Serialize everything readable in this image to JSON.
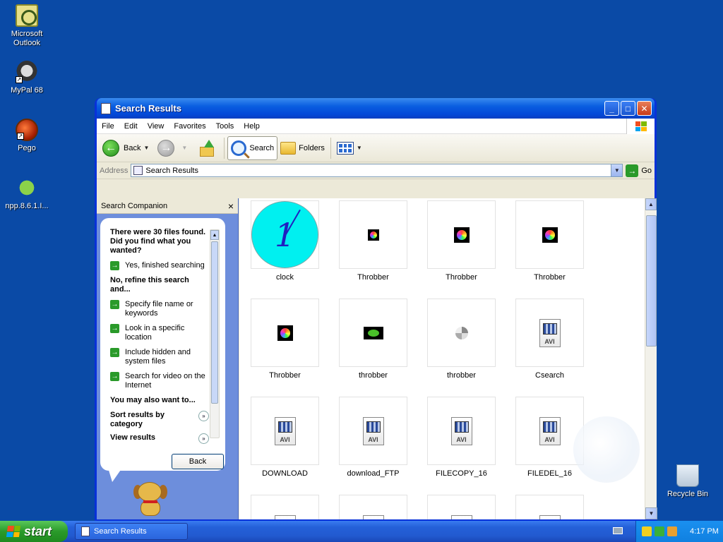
{
  "desktop": {
    "icons": [
      {
        "label": "Microsoft Outlook",
        "icon": "outlook-icon"
      },
      {
        "label": "MyPal 68",
        "icon": "mypal-icon"
      },
      {
        "label": "Pego",
        "icon": "pego-icon"
      },
      {
        "label": "npp.8.6.1.I...",
        "icon": "npp-installer-icon"
      },
      {
        "label": "Recycle Bin",
        "icon": "recycle-bin-icon"
      }
    ]
  },
  "window": {
    "title": "Search Results",
    "menu": [
      "File",
      "Edit",
      "View",
      "Favorites",
      "Tools",
      "Help"
    ],
    "toolbar": {
      "back": "Back",
      "search": "Search",
      "folders": "Folders"
    },
    "address": {
      "label": "Address",
      "value": "Search Results",
      "go": "Go"
    }
  },
  "companion": {
    "title": "Search Companion",
    "close": "×",
    "question": "There were 30 files found. Did you find what you wanted?",
    "yes_option": "Yes, finished searching",
    "refine_heading": "No, refine this search and...",
    "refine_options": [
      "Specify file name or keywords",
      "Look in a specific location",
      "Include hidden and system files",
      "Search for video on the Internet"
    ],
    "also_heading": "You may also want to...",
    "also_options": [
      "Sort results by category",
      "View results"
    ],
    "back_button": "Back"
  },
  "files": [
    {
      "name": "clock",
      "thumb": "clock"
    },
    {
      "name": "Throbber",
      "thumb": "throbber-small"
    },
    {
      "name": "Throbber",
      "thumb": "throbber"
    },
    {
      "name": "Throbber",
      "thumb": "throbber"
    },
    {
      "name": "Throbber",
      "thumb": "throbber"
    },
    {
      "name": "throbber",
      "thumb": "frog"
    },
    {
      "name": "throbber",
      "thumb": "spinner"
    },
    {
      "name": "Csearch",
      "thumb": "avi"
    },
    {
      "name": "DOWNLOAD",
      "thumb": "avi"
    },
    {
      "name": "download_FTP",
      "thumb": "avi"
    },
    {
      "name": "FILECOPY_16",
      "thumb": "avi"
    },
    {
      "name": "FILEDEL_16",
      "thumb": "avi"
    },
    {
      "name": "",
      "thumb": "avi"
    },
    {
      "name": "",
      "thumb": "avi"
    },
    {
      "name": "",
      "thumb": "avi"
    },
    {
      "name": "",
      "thumb": "avi"
    }
  ],
  "taskbar": {
    "start": "start",
    "task_button": "Search Results",
    "clock": "4:17 PM"
  },
  "colors": {
    "desktop": "#0a4aa6",
    "titlebar": "#0a5ee0",
    "taskbar": "#245edc",
    "start": "#2a9a2a"
  }
}
